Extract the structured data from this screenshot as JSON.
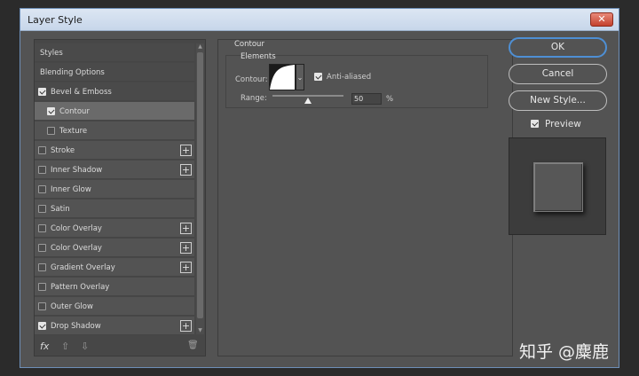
{
  "window": {
    "title": "Layer Style",
    "close_glyph": "✕"
  },
  "sidebar": {
    "items": [
      {
        "label": "Styles",
        "checkbox": false,
        "checked": false,
        "plus": false,
        "indent": false,
        "state": "header"
      },
      {
        "label": "Blending Options",
        "checkbox": false,
        "checked": false,
        "plus": false,
        "indent": false,
        "state": "header"
      },
      {
        "label": "Bevel & Emboss",
        "checkbox": true,
        "checked": true,
        "plus": false,
        "indent": false,
        "state": "active-parent"
      },
      {
        "label": "Contour",
        "checkbox": true,
        "checked": true,
        "plus": false,
        "indent": true,
        "state": "selected"
      },
      {
        "label": "Texture",
        "checkbox": true,
        "checked": false,
        "plus": false,
        "indent": true,
        "state": "normal"
      },
      {
        "label": "Stroke",
        "checkbox": true,
        "checked": false,
        "plus": true,
        "indent": false,
        "state": "normal"
      },
      {
        "label": "Inner Shadow",
        "checkbox": true,
        "checked": false,
        "plus": true,
        "indent": false,
        "state": "normal"
      },
      {
        "label": "Inner Glow",
        "checkbox": true,
        "checked": false,
        "plus": false,
        "indent": false,
        "state": "normal"
      },
      {
        "label": "Satin",
        "checkbox": true,
        "checked": false,
        "plus": false,
        "indent": false,
        "state": "normal"
      },
      {
        "label": "Color Overlay",
        "checkbox": true,
        "checked": false,
        "plus": true,
        "indent": false,
        "state": "normal"
      },
      {
        "label": "Color Overlay",
        "checkbox": true,
        "checked": false,
        "plus": true,
        "indent": false,
        "state": "normal"
      },
      {
        "label": "Gradient Overlay",
        "checkbox": true,
        "checked": false,
        "plus": true,
        "indent": false,
        "state": "normal"
      },
      {
        "label": "Pattern Overlay",
        "checkbox": true,
        "checked": false,
        "plus": false,
        "indent": false,
        "state": "normal"
      },
      {
        "label": "Outer Glow",
        "checkbox": true,
        "checked": false,
        "plus": false,
        "indent": false,
        "state": "normal"
      },
      {
        "label": "Drop Shadow",
        "checkbox": true,
        "checked": true,
        "plus": true,
        "indent": false,
        "state": "normal"
      }
    ],
    "plus_glyph": "+",
    "tools": {
      "fx": "fx",
      "up": "⇧",
      "down": "⇩",
      "trash": "🗑"
    }
  },
  "panel": {
    "group_title": "Contour",
    "sub_title": "Elements",
    "contour_label": "Contour:",
    "antialiased_label": "Anti-aliased",
    "antialiased_checked": true,
    "range_label": "Range:",
    "range_value": "50",
    "range_fraction": 0.5,
    "range_unit": "%",
    "dropdown_glyph": "⌄"
  },
  "buttons": {
    "ok": "OK",
    "cancel": "Cancel",
    "new_style": "New Style..."
  },
  "preview": {
    "label": "Preview",
    "checked": true
  },
  "watermark": "知乎 @麋鹿"
}
